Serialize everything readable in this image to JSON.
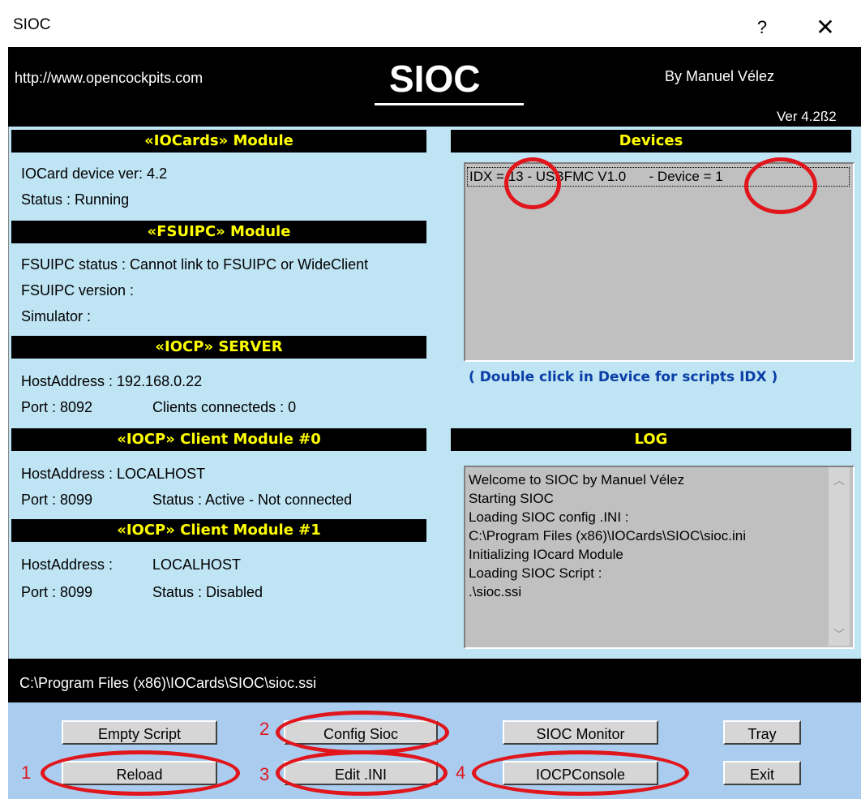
{
  "window": {
    "title": "SIOC",
    "help": "?",
    "close": "✕"
  },
  "header": {
    "site": "http://www.opencockpits.com",
    "title": "SIOC",
    "author": "By Manuel Vélez",
    "version": "Ver 4.2ß2"
  },
  "iocards": {
    "heading": "«IOCards» Module",
    "device_ver": "IOCard device ver:  4.2",
    "status": "Status : Running"
  },
  "fsuipc": {
    "heading": "«FSUIPC» Module",
    "status": "FSUIPC status :  Cannot link to FSUIPC or WideClient",
    "version": "FSUIPC version :",
    "simulator": "Simulator :"
  },
  "iocp_server": {
    "heading": "«IOCP» SERVER",
    "host": "HostAddress :  192.168.0.22",
    "port": "Port :  8092",
    "clients": "Clients connecteds :  0"
  },
  "client0": {
    "heading": "«IOCP» Client Module #0",
    "host": "HostAddress :  LOCALHOST",
    "port": "Port :  8099",
    "status": "Status : Active - Not connected"
  },
  "client1": {
    "heading": "«IOCP» Client Module #1",
    "host_label": "HostAddress :",
    "host_value": "LOCALHOST",
    "port": "Port :  8099",
    "status": "Status : Disabled"
  },
  "devices": {
    "heading": "Devices",
    "row": "IDX = 13 - USBFMC V1.0      - Device = 1",
    "hint": "( Double click in Device for scripts IDX )"
  },
  "log": {
    "heading": "LOG",
    "lines": [
      "Welcome to SIOC by Manuel Vélez",
      "Starting SIOC",
      "Loading SIOC config .INI :",
      "C:\\Program Files (x86)\\IOCards\\SIOC\\sioc.ini",
      "Initializing IOcard Module",
      "Loading SIOC Script :",
      ".\\sioc.ssi"
    ]
  },
  "path": "C:\\Program Files (x86)\\IOCards\\SIOC\\sioc.ssi",
  "buttons": {
    "empty_script": "Empty Script",
    "reload": "Reload",
    "config_sioc": "Config Sioc",
    "edit_ini": "Edit .INI",
    "sioc_monitor": "SIOC Monitor",
    "iocp_console": "IOCPConsole",
    "tray": "Tray",
    "exit": "Exit"
  },
  "annotations": {
    "n1": "1",
    "n2": "2",
    "n3": "3",
    "n4": "4",
    "color": "#e0161c"
  },
  "colors": {
    "panel_bg": "#bfe4f4",
    "heading_text": "#ffff00",
    "bottom_bg": "#a9ccef",
    "hint": "#0a3ea6"
  }
}
